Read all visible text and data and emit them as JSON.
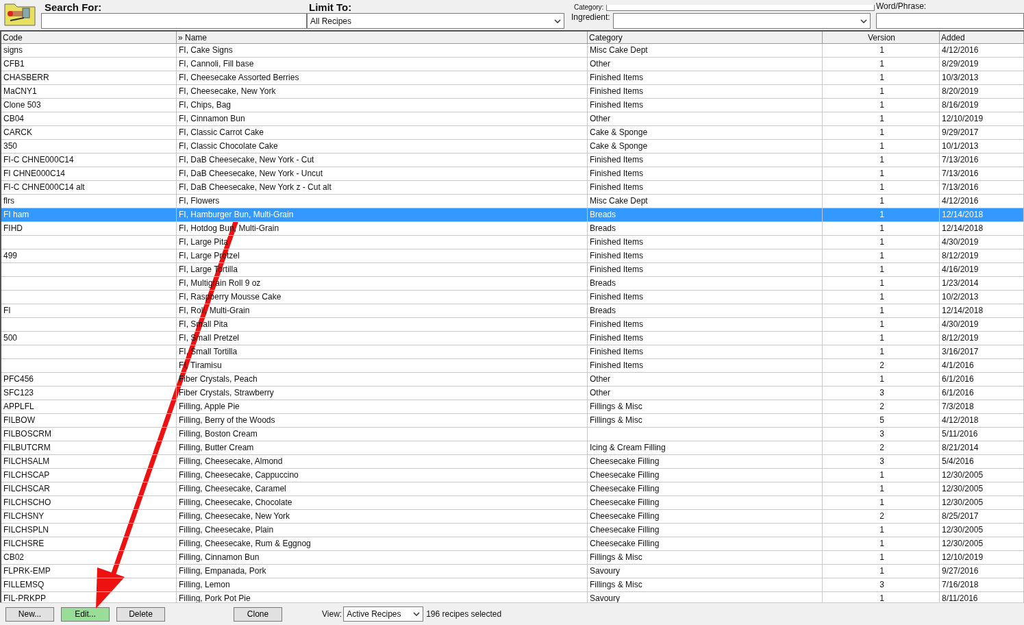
{
  "search": {
    "label": "Search For:"
  },
  "limit": {
    "label": "Limit To:",
    "value": "All Recipes"
  },
  "category_filter": {
    "label": "Category:"
  },
  "ingredient_filter": {
    "label": "Ingredient:"
  },
  "word_phrase": {
    "label": "Word/Phrase:"
  },
  "table": {
    "columns": [
      {
        "label": "Code"
      },
      {
        "label": "» Name"
      },
      {
        "label": "Category"
      },
      {
        "label": "Version"
      },
      {
        "label": "Added"
      }
    ],
    "rows": [
      {
        "code": "signs",
        "name": "FI, Cake Signs",
        "category": "Misc Cake Dept",
        "version": "1",
        "added": "4/12/2016",
        "selected": false
      },
      {
        "code": "CFB1",
        "name": "FI, Cannoli, Fill base",
        "category": "Other",
        "version": "1",
        "added": "8/29/2019",
        "selected": false
      },
      {
        "code": "CHASBERR",
        "name": "FI, Cheesecake Assorted Berries",
        "category": "Finished Items",
        "version": "1",
        "added": "10/3/2013",
        "selected": false
      },
      {
        "code": "MaCNY1",
        "name": "FI, Cheesecake, New York",
        "category": "Finished Items",
        "version": "1",
        "added": "8/20/2019",
        "selected": false
      },
      {
        "code": "Clone 503",
        "name": "FI, Chips, Bag",
        "category": "Finished Items",
        "version": "1",
        "added": "8/16/2019",
        "selected": false
      },
      {
        "code": "CB04",
        "name": "FI, Cinnamon Bun",
        "category": "Other",
        "version": "1",
        "added": "12/10/2019",
        "selected": false
      },
      {
        "code": "CARCK",
        "name": "FI, Classic Carrot Cake",
        "category": "Cake & Sponge",
        "version": "1",
        "added": "9/29/2017",
        "selected": false
      },
      {
        "code": "350",
        "name": "FI, Classic Chocolate Cake",
        "category": "Cake & Sponge",
        "version": "1",
        "added": "10/1/2013",
        "selected": false
      },
      {
        "code": "FI-C CHNE000C14",
        "name": "FI, DaB Cheesecake, New York - Cut",
        "category": "Finished Items",
        "version": "1",
        "added": "7/13/2016",
        "selected": false
      },
      {
        "code": "FI CHNE000C14",
        "name": "FI, DaB Cheesecake, New York - Uncut",
        "category": "Finished Items",
        "version": "1",
        "added": "7/13/2016",
        "selected": false
      },
      {
        "code": "FI-C CHNE000C14 alt",
        "name": "FI, DaB Cheesecake, New York z - Cut alt",
        "category": "Finished Items",
        "version": "1",
        "added": "7/13/2016",
        "selected": false
      },
      {
        "code": "flrs",
        "name": "FI, Flowers",
        "category": "Misc Cake Dept",
        "version": "1",
        "added": "4/12/2016",
        "selected": false
      },
      {
        "code": "FI ham",
        "name": "FI, Hamburger Bun, Multi-Grain",
        "category": "Breads",
        "version": "1",
        "added": "12/14/2018",
        "selected": true
      },
      {
        "code": "FIHD",
        "name": "FI, Hotdog Bun, Multi-Grain",
        "category": "Breads",
        "version": "1",
        "added": "12/14/2018",
        "selected": false
      },
      {
        "name": "FI, Large Pita",
        "category": "Finished Items",
        "version": "1",
        "added": "4/30/2019",
        "selected": false
      },
      {
        "code": "499",
        "name": "FI, Large Pretzel",
        "category": "Finished Items",
        "version": "1",
        "added": "8/12/2019",
        "selected": false
      },
      {
        "name": "FI, Large Tortilla",
        "category": "Finished Items",
        "version": "1",
        "added": "4/16/2019",
        "selected": false
      },
      {
        "name": "FI, Multigrain Roll 9 oz",
        "category": "Breads",
        "version": "1",
        "added": "1/23/2014",
        "selected": false
      },
      {
        "name": "FI, Raspberry Mousse Cake",
        "category": "Finished Items",
        "version": "1",
        "added": "10/2/2013",
        "selected": false
      },
      {
        "code": "FI",
        "name": "FI, Roll, Multi-Grain",
        "category": "Breads",
        "version": "1",
        "added": "12/14/2018",
        "selected": false
      },
      {
        "name": "FI, Small Pita",
        "category": "Finished Items",
        "version": "1",
        "added": "4/30/2019",
        "selected": false
      },
      {
        "code": "500",
        "name": "FI, Small Pretzel",
        "category": "Finished Items",
        "version": "1",
        "added": "8/12/2019",
        "selected": false
      },
      {
        "name": "FI, Small Tortilla",
        "category": "Finished Items",
        "version": "1",
        "added": "3/16/2017",
        "selected": false
      },
      {
        "name": "FI, Tiramisu",
        "category": "Finished Items",
        "version": "2",
        "added": "4/1/2016",
        "selected": false
      },
      {
        "code": "PFC456",
        "name": "Fiber Crystals, Peach",
        "category": "Other",
        "version": "1",
        "added": "6/1/2016",
        "selected": false
      },
      {
        "code": "SFC123",
        "name": "Fiber Crystals, Strawberry",
        "category": "Other",
        "version": "3",
        "added": "6/1/2016",
        "selected": false
      },
      {
        "code": "APPLFL",
        "name": "Filling, Apple Pie",
        "category": "Fillings & Misc",
        "version": "2",
        "added": "7/3/2018",
        "selected": false
      },
      {
        "code": "FILBOW",
        "name": "Filling, Berry of the Woods",
        "category": "Fillings & Misc",
        "version": "5",
        "added": "4/12/2018",
        "selected": false
      },
      {
        "code": "FILBOSCRM",
        "name": "Filling, Boston Cream",
        "version": "3",
        "added": "5/11/2016",
        "selected": false
      },
      {
        "code": "FILBUTCRM",
        "name": "Filling, Butter Cream",
        "category": "Icing & Cream Filling",
        "version": "2",
        "added": "8/21/2014",
        "selected": false
      },
      {
        "code": "FILCHSALM",
        "name": "Filling, Cheesecake, Almond",
        "category": "Cheesecake Filling",
        "version": "3",
        "added": "5/4/2016",
        "selected": false
      },
      {
        "code": "FILCHSCAP",
        "name": "Filling, Cheesecake, Cappuccino",
        "category": "Cheesecake Filling",
        "version": "1",
        "added": "12/30/2005",
        "selected": false
      },
      {
        "code": "FILCHSCAR",
        "name": "Filling, Cheesecake, Caramel",
        "category": "Cheesecake Filling",
        "version": "1",
        "added": "12/30/2005",
        "selected": false
      },
      {
        "code": "FILCHSCHO",
        "name": "Filling, Cheesecake, Chocolate",
        "category": "Cheesecake Filling",
        "version": "1",
        "added": "12/30/2005",
        "selected": false
      },
      {
        "code": "FILCHSNY",
        "name": "Filling, Cheesecake, New York",
        "category": "Cheesecake Filling",
        "version": "2",
        "added": "8/25/2017",
        "selected": false
      },
      {
        "code": "FILCHSPLN",
        "name": "Filling, Cheesecake, Plain",
        "category": "Cheesecake Filling",
        "version": "1",
        "added": "12/30/2005",
        "selected": false
      },
      {
        "code": "FILCHSRE",
        "name": "Filling, Cheesecake, Rum & Eggnog",
        "category": "Cheesecake Filling",
        "version": "1",
        "added": "12/30/2005",
        "selected": false
      },
      {
        "code": "CB02",
        "name": "Filling, Cinnamon Bun",
        "category": "Fillings & Misc",
        "version": "1",
        "added": "12/10/2019",
        "selected": false
      },
      {
        "code": "FLPRK-EMP",
        "name": "Filling, Empanada, Pork",
        "category": "Savoury",
        "version": "1",
        "added": "9/27/2016",
        "selected": false
      },
      {
        "code": "FILLEMSQ",
        "name": "Filling, Lemon",
        "category": "Fillings & Misc",
        "version": "3",
        "added": "7/16/2018",
        "selected": false
      },
      {
        "code": "FIL-PRKPP",
        "name": "Filling, Pork Pot Pie",
        "category": "Savoury",
        "version": "1",
        "added": "8/11/2016",
        "selected": false
      }
    ]
  },
  "buttons": [
    {
      "label": "New...",
      "highlighted": false
    },
    {
      "label": "Edit...",
      "highlighted": true
    },
    {
      "label": "Delete",
      "highlighted": false
    },
    {
      "label": "Clone",
      "highlighted": false
    }
  ],
  "view": {
    "label": "View:",
    "value": "Active Recipes"
  },
  "status": "196 recipes selected"
}
